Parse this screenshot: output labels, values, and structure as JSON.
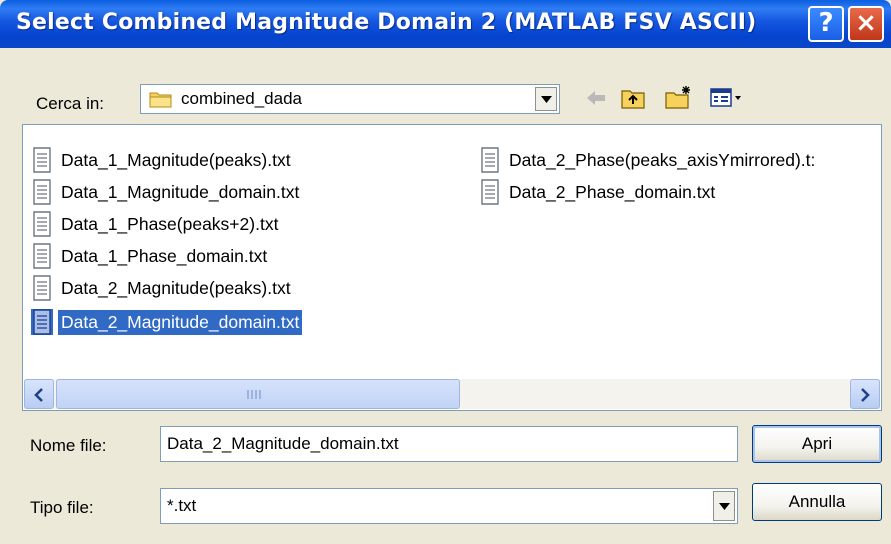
{
  "window": {
    "title": "Select Combined Magnitude Domain 2 (MATLAB FSV ASCII)",
    "help_glyph": "?",
    "close_glyph": "×"
  },
  "lookin": {
    "label": "Cerca in:",
    "folder": "combined_dada"
  },
  "toolbar_icons": [
    "back-arrow-icon",
    "up-one-level-icon",
    "new-folder-icon",
    "view-menu-icon"
  ],
  "files": [
    {
      "name": "Data_1_Magnitude(peaks).txt"
    },
    {
      "name": "Data_1_Magnitude_domain.txt"
    },
    {
      "name": "Data_1_Phase(peaks+2).txt"
    },
    {
      "name": "Data_1_Phase_domain.txt"
    },
    {
      "name": "Data_2_Magnitude(peaks).txt"
    },
    {
      "name": "Data_2_Magnitude_domain.txt",
      "selected": true
    },
    {
      "name": "Data_2_Phase(peaks_axisYmirrored).t:"
    },
    {
      "name": "Data_2_Phase_domain.txt"
    }
  ],
  "filename": {
    "label": "Nome file:",
    "value": "Data_2_Magnitude_domain.txt"
  },
  "filetype": {
    "label": "Tipo file:",
    "value": "*.txt"
  },
  "buttons": {
    "open": "Apri",
    "cancel": "Annulla"
  },
  "colors": {
    "selection": "#316ac5",
    "titlebar": "#0a46c8",
    "dialog_bg": "#ece9d8"
  }
}
